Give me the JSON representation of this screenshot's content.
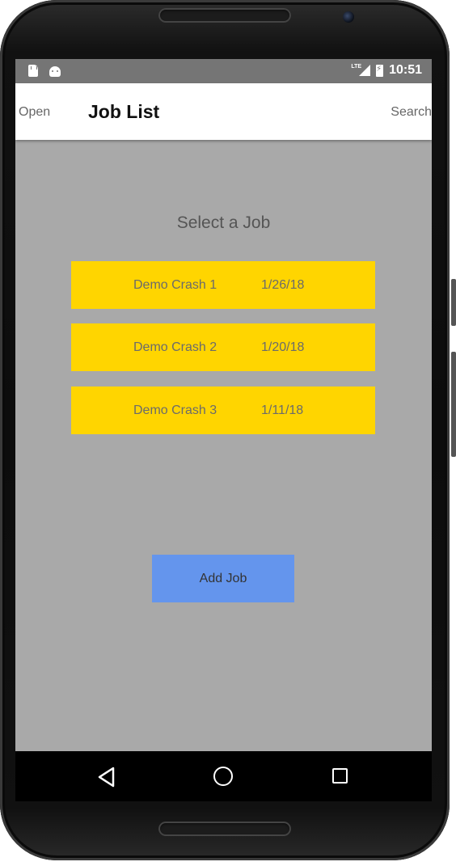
{
  "status_bar": {
    "network": "LTE",
    "time": "10:51"
  },
  "navbar": {
    "open_label": "Open",
    "title": "Job List",
    "search_label": "Search"
  },
  "main": {
    "heading": "Select a Job",
    "jobs": [
      {
        "name": "Demo Crash 1",
        "date": "1/26/18"
      },
      {
        "name": "Demo Crash 2",
        "date": "1/20/18"
      },
      {
        "name": "Demo Crash 3",
        "date": "1/11/18"
      }
    ],
    "add_button": "Add Job"
  },
  "colors": {
    "job_row": "#ffd500",
    "add_button": "#6495ed",
    "background": "#a9a9a9"
  },
  "icons": [
    "sd-card-icon",
    "android-icon",
    "signal-icon",
    "battery-icon",
    "back-icon",
    "home-icon",
    "recent-apps-icon"
  ]
}
